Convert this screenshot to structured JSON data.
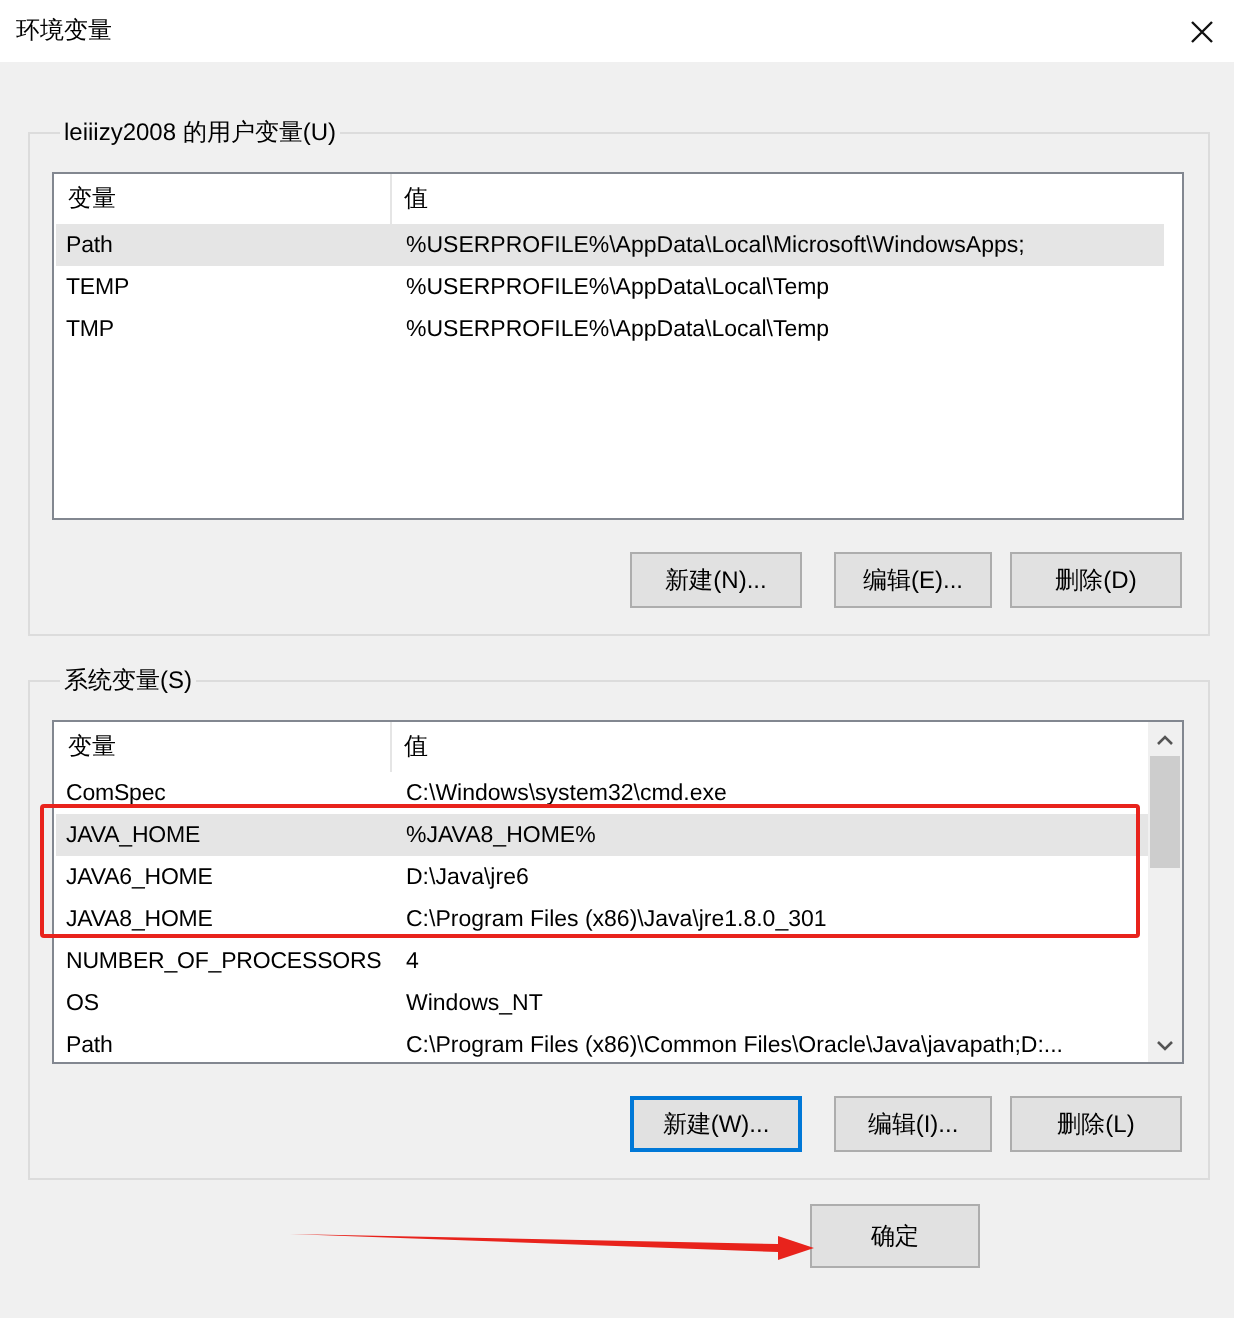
{
  "window": {
    "title": "环境变量"
  },
  "user_variables": {
    "label": "leiiizy2008 的用户变量(U)",
    "columns": [
      "变量",
      "值"
    ],
    "rows": [
      {
        "name": "Path",
        "value": "%USERPROFILE%\\AppData\\Local\\Microsoft\\WindowsApps;",
        "selected": true
      },
      {
        "name": "TEMP",
        "value": "%USERPROFILE%\\AppData\\Local\\Temp",
        "selected": false
      },
      {
        "name": "TMP",
        "value": "%USERPROFILE%\\AppData\\Local\\Temp",
        "selected": false
      }
    ],
    "buttons": [
      {
        "label": "新建(N)...",
        "focused": false
      },
      {
        "label": "编辑(E)...",
        "focused": false
      },
      {
        "label": "删除(D)",
        "focused": false
      }
    ]
  },
  "system_variables": {
    "label": "系统变量(S)",
    "columns": [
      "变量",
      "值"
    ],
    "rows": [
      {
        "name": "ComSpec",
        "value": "C:\\Windows\\system32\\cmd.exe",
        "selected": false
      },
      {
        "name": "JAVA_HOME",
        "value": "%JAVA8_HOME%",
        "selected": true
      },
      {
        "name": "JAVA6_HOME",
        "value": "D:\\Java\\jre6",
        "selected": false
      },
      {
        "name": "JAVA8_HOME",
        "value": "C:\\Program Files (x86)\\Java\\jre1.8.0_301",
        "selected": false
      },
      {
        "name": "NUMBER_OF_PROCESSORS",
        "value": "4",
        "selected": false
      },
      {
        "name": "OS",
        "value": "Windows_NT",
        "selected": false
      },
      {
        "name": "Path",
        "value": "C:\\Program Files (x86)\\Common Files\\Oracle\\Java\\javapath;D:...",
        "selected": false
      }
    ],
    "buttons": [
      {
        "label": "新建(W)...",
        "focused": true
      },
      {
        "label": "编辑(I)...",
        "focused": false
      },
      {
        "label": "删除(L)",
        "focused": false
      }
    ]
  },
  "footer_buttons": [
    {
      "label": "确定"
    }
  ]
}
